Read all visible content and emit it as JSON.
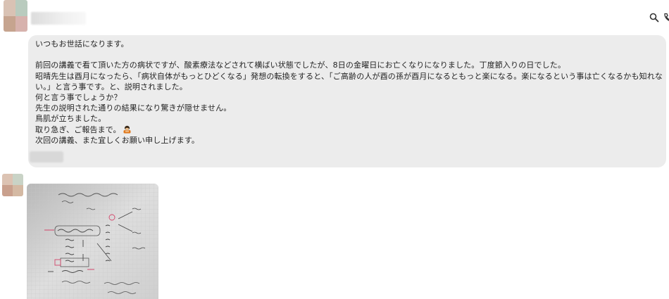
{
  "header": {
    "icons": [
      "search-icon",
      "phone-icon"
    ]
  },
  "message": {
    "lines": [
      "いつもお世話になります。",
      "",
      "前回の講義で看て頂いた方の病状ですが、酸素療法などされて横ばい状態でしたが、8日の金曜日にお亡くなりになりました。丁度節入りの日でした。",
      "昭晴先生は酉月になったら、「病状自体がもっとひどくなる」発想の転換をすると、「ご高齢の人が酉の孫が酉月になるともっと楽になる。楽になるという事は亡くなるかも知れな",
      "い。」と言う事です。と、説明されました。",
      "何と言う事でしょうか？",
      "先生の説明された通りの結果になり驚きが隠せません。",
      "鳥肌が立ちました。",
      "取り急ぎ、ご報告まで。",
      "次回の講義、また宜しくお願い申し上げます。"
    ],
    "emoji": "person-bowing-emoji"
  },
  "photo": {
    "description_icon": "handwritten-notes-image"
  },
  "colors": {
    "bubble_bg": "#ececec",
    "page_bg": "#ffffff",
    "text": "#222222"
  }
}
